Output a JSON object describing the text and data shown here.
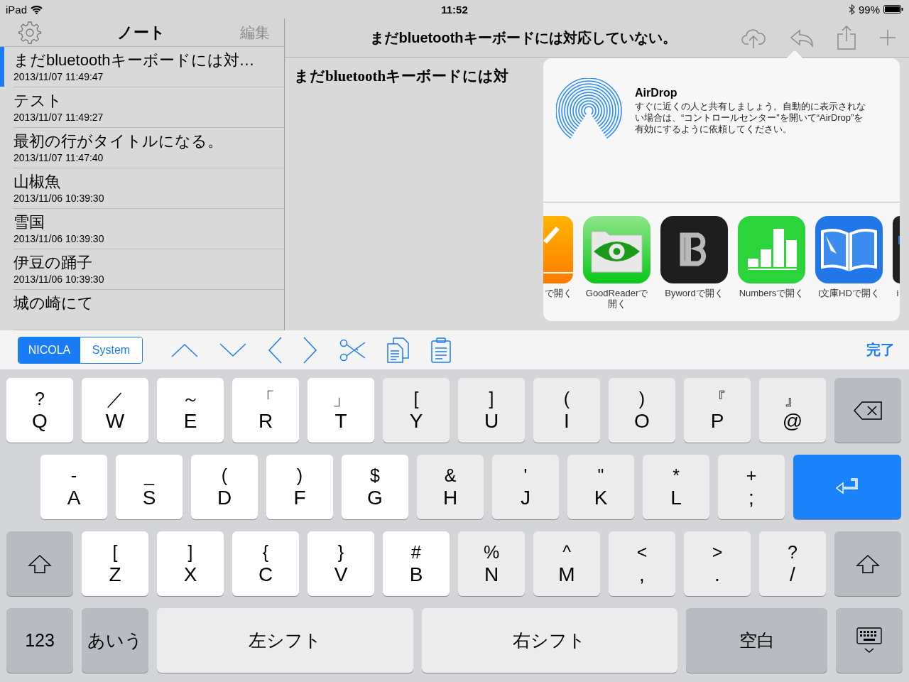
{
  "status_bar": {
    "device": "iPad",
    "time": "11:52",
    "battery": "99%"
  },
  "sidebar": {
    "title": "ノート",
    "edit": "編集",
    "notes": [
      {
        "title": "まだbluetoothキーボードには対…",
        "date": "2013/11/07 11:49:47",
        "selected": true
      },
      {
        "title": "テスト",
        "date": "2013/11/07 11:49:27",
        "selected": false
      },
      {
        "title": "最初の行がタイトルになる。",
        "date": "2013/11/07 11:47:40",
        "selected": false
      },
      {
        "title": "山椒魚",
        "date": "2013/11/06 10:39:30",
        "selected": false
      },
      {
        "title": "雪国",
        "date": "2013/11/06 10:39:30",
        "selected": false
      },
      {
        "title": "伊豆の踊子",
        "date": "2013/11/06 10:39:30",
        "selected": false
      },
      {
        "title": "城の崎にて",
        "selected": false
      }
    ]
  },
  "editor": {
    "title": "まだbluetoothキーボードには対応していない。",
    "text": "まだbluetoothキーボードには対"
  },
  "share_sheet": {
    "airdrop_title": "AirDrop",
    "airdrop_text": "すぐに近くの人と共有しましょう。自動的に表示されない場合は、“コントロールセンター”を開いて“AirDrop”を有効にするように依頼してください。",
    "apps": [
      {
        "kind": "pages",
        "label": "で開く"
      },
      {
        "kind": "goodreader",
        "label": "GoodReaderで開く"
      },
      {
        "kind": "byword",
        "label": "Bywordで開く"
      },
      {
        "kind": "numbers",
        "label": "Numbersで開く"
      },
      {
        "kind": "ibunko",
        "label": "i文庫HDで開く"
      },
      {
        "kind": "cut",
        "label": "i"
      }
    ]
  },
  "toolbar": {
    "modes": [
      {
        "label": "NICOLA",
        "selected": true
      },
      {
        "label": "System",
        "selected": false
      }
    ],
    "done": "完了"
  },
  "keyboard": {
    "rows": [
      {
        "keys": [
          {
            "kind": "left",
            "top": "?",
            "main": "Q"
          },
          {
            "kind": "left",
            "top": "／",
            "main": "W"
          },
          {
            "kind": "left",
            "top": "～",
            "main": "E"
          },
          {
            "kind": "left",
            "top": "「",
            "main": "R"
          },
          {
            "kind": "left",
            "top": "」",
            "main": "T"
          },
          {
            "kind": "right",
            "top": "[",
            "main": "Y"
          },
          {
            "kind": "right",
            "top": "]",
            "main": "U"
          },
          {
            "kind": "right",
            "top": "(",
            "main": "I"
          },
          {
            "kind": "right",
            "top": ")",
            "main": "O"
          },
          {
            "kind": "right",
            "top": "『",
            "main": "P"
          },
          {
            "kind": "right",
            "top": "』",
            "main": "@"
          },
          {
            "kind": "delete"
          }
        ]
      },
      {
        "keys": [
          {
            "kind": "left",
            "top": "-",
            "main": "A"
          },
          {
            "kind": "left",
            "top": "_",
            "main": "S"
          },
          {
            "kind": "left",
            "top": "(",
            "main": "D"
          },
          {
            "kind": "left",
            "top": ")",
            "main": "F"
          },
          {
            "kind": "left",
            "top": "$",
            "main": "G"
          },
          {
            "kind": "right",
            "top": "&",
            "main": "H"
          },
          {
            "kind": "right",
            "top": "'",
            "main": "J"
          },
          {
            "kind": "right",
            "top": "\"",
            "main": "K"
          },
          {
            "kind": "right",
            "top": "*",
            "main": "L"
          },
          {
            "kind": "right",
            "top": "+",
            "main": ";"
          },
          {
            "kind": "return"
          }
        ]
      },
      {
        "keys": [
          {
            "kind": "shift"
          },
          {
            "kind": "left",
            "top": "[",
            "main": "Z"
          },
          {
            "kind": "left",
            "top": "]",
            "main": "X"
          },
          {
            "kind": "left",
            "top": "{",
            "main": "C"
          },
          {
            "kind": "left",
            "top": "}",
            "main": "V"
          },
          {
            "kind": "left",
            "top": "#",
            "main": "B"
          },
          {
            "kind": "right",
            "top": "%",
            "main": "N"
          },
          {
            "kind": "right",
            "top": "^",
            "main": "M"
          },
          {
            "kind": "right",
            "top": "<",
            "main": ","
          },
          {
            "kind": "right",
            "top": ">",
            "main": "."
          },
          {
            "kind": "right",
            "top": "?",
            "main": "/"
          },
          {
            "kind": "shift"
          }
        ]
      },
      {
        "keys": [
          {
            "kind": "fn",
            "main": "123"
          },
          {
            "kind": "fn",
            "main": "あいう"
          },
          {
            "kind": "thumb",
            "main": "左シフト"
          },
          {
            "kind": "thumb",
            "main": "右シフト"
          },
          {
            "kind": "space",
            "main": "空白"
          },
          {
            "kind": "hide"
          }
        ]
      }
    ]
  }
}
